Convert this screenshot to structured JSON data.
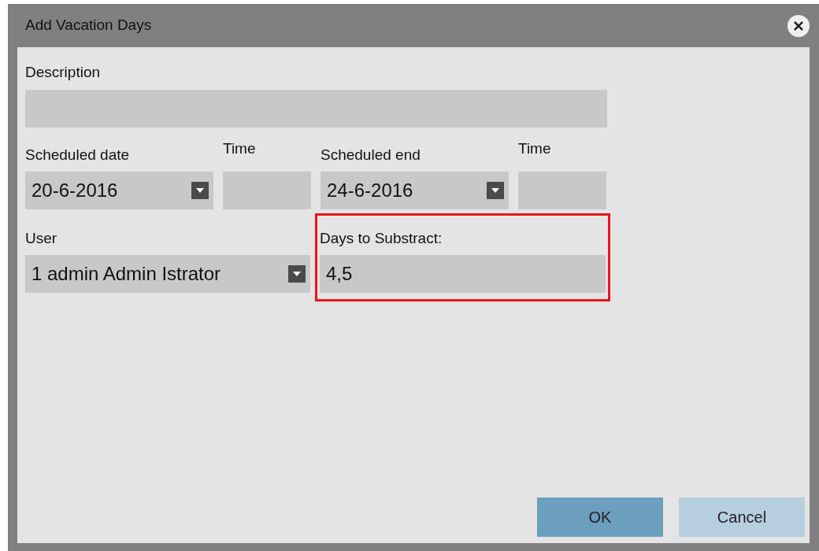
{
  "window": {
    "title": "Add Vacation Days"
  },
  "fields": [
    {
      "kind": "text",
      "label": "Description"
    },
    {
      "kind": "combo",
      "label": "Scheduled date",
      "value": "20-6-2016"
    },
    {
      "kind": "text",
      "label": "Time"
    },
    {
      "kind": "combo",
      "label": "Scheduled end",
      "value": "24-6-2016"
    },
    {
      "kind": "text",
      "label": "Time"
    },
    {
      "kind": "combo",
      "label": "User",
      "value": "1 admin Admin Istrator"
    },
    {
      "kind": "text",
      "label": "Days to Substract:",
      "value": "4,5",
      "highlighted": true
    }
  ],
  "buttons": [
    {
      "label": "OK",
      "kind": "primary"
    },
    {
      "label": "Cancel",
      "kind": "secondary"
    }
  ]
}
